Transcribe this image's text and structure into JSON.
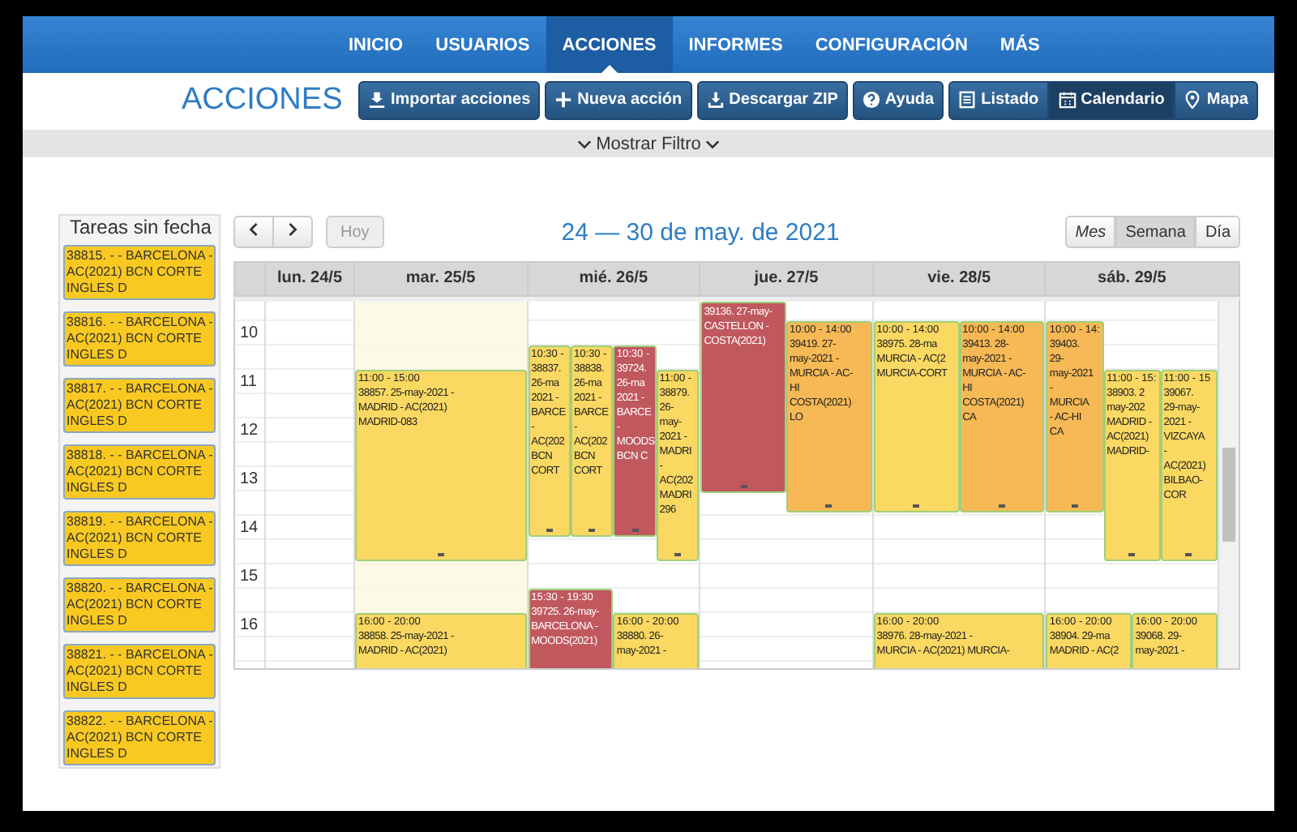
{
  "nav": [
    {
      "label": "INICIO",
      "selected": false
    },
    {
      "label": "USUARIOS",
      "selected": false
    },
    {
      "label": "ACCIONES",
      "selected": true
    },
    {
      "label": "INFORMES",
      "selected": false
    },
    {
      "label": "CONFIGURACIÓN",
      "selected": false
    },
    {
      "label": "MÁS",
      "selected": false
    }
  ],
  "page_title": "ACCIONES",
  "actions": [
    "Importar acciones",
    "Nueva acción",
    "Descargar ZIP",
    "Ayuda"
  ],
  "views": [
    {
      "label": "Listado",
      "selected": false
    },
    {
      "label": "Calendario",
      "selected": true
    },
    {
      "label": "Mapa",
      "selected": false
    }
  ],
  "filter_toggle": "Mostrar Filtro",
  "sidebar": {
    "title": "Tareas sin fecha",
    "tasks": [
      "38815. - - BARCELONA - AC(2021) BCN CORTE INGLES D",
      "38816. - - BARCELONA - AC(2021) BCN CORTE INGLES D",
      "38817. - - BARCELONA - AC(2021) BCN CORTE INGLES D",
      "38818. - - BARCELONA - AC(2021) BCN CORTE INGLES D",
      "38819. - - BARCELONA - AC(2021) BCN CORTE INGLES D",
      "38820. - - BARCELONA - AC(2021) BCN CORTE INGLES D",
      "38821. - - BARCELONA - AC(2021) BCN CORTE INGLES D",
      "38822. - - BARCELONA - AC(2021) BCN CORTE INGLES D"
    ]
  },
  "calendar": {
    "today_button": {
      "label": "Hoy",
      "disabled": true
    },
    "range_title": "24 — 30 de may. de 2021",
    "modes": [
      {
        "label": "Mes",
        "selected": false
      },
      {
        "label": "Semana",
        "selected": true
      },
      {
        "label": "Día",
        "selected": false
      }
    ],
    "hours": [
      "10",
      "11",
      "12",
      "13",
      "14",
      "15",
      "16"
    ],
    "days": [
      {
        "label": "lun. 24/5",
        "today": false
      },
      {
        "label": "mar. 25/5",
        "today": true,
        "events": [
          {
            "time": "11:00 - 15:00",
            "text": "38857. 25-may-2021 -\nMADRID - AC(2021)\nMADRID-083",
            "color": "#fad862"
          },
          {
            "time": "16:00 - 20:00",
            "text": "38858. 25-may-2021 -\nMADRID - AC(2021)",
            "color": "#fad862"
          }
        ]
      },
      {
        "label": "mié. 26/5",
        "today": false,
        "events": [
          {
            "time": "10:30 -",
            "text": "38837.\n26-ma\n2021 -\nBARCE\n-\nAC(202\nBCN\nCORT",
            "color": "#fad862"
          },
          {
            "time": "10:30 -",
            "text": "38838.\n26-ma\n2021 -\nBARCE\n-\nAC(202\nBCN\nCORT",
            "color": "#fad862"
          },
          {
            "time": "10:30 -",
            "text": "39724.\n26-ma\n2021 -\nBARCE\n-\nMOODS\nBCN C",
            "color": "#c0585e"
          },
          {
            "time": "11:00 -",
            "text": "38879.\n26-\nmay-\n2021 -\nMADRI\n-\nAC(202\nMADRI\n296",
            "color": "#fad862"
          },
          {
            "time": "15:30 - 19:30",
            "text": "39725. 26-may-\nBARCELONA -\nMOODS(2021)",
            "color": "#c0585e"
          },
          {
            "time": "16:00 - 20:00",
            "text": "38880. 26-\nmay-2021 -",
            "color": "#fad862"
          }
        ]
      },
      {
        "label": "jue. 27/5",
        "today": false,
        "events": [
          {
            "text": "39136. 27-may-\nCASTELLON -\nCOSTA(2021)",
            "color": "#c0585e"
          },
          {
            "time": "10:00 - 14:00",
            "text": "39419. 27-\nmay-2021 -\nMURCIA - AC-\nHI\nCOSTA(2021)\nLO",
            "color": "#f7b955"
          }
        ]
      },
      {
        "label": "vie. 28/5",
        "today": false,
        "events": [
          {
            "time": "10:00 - 14:00",
            "text": "38975. 28-ma\nMURCIA - AC(2\nMURCIA-CORT",
            "color": "#fad862"
          },
          {
            "time": "10:00 - 14:00",
            "text": "39413. 28-\nmay-2021 -\nMURCIA - AC-\nHI\nCOSTA(2021)\nCA",
            "color": "#f7b955"
          },
          {
            "time": "16:00 - 20:00",
            "text": "38976. 28-may-2021 -\nMURCIA - AC(2021) MURCIA-",
            "color": "#fad862"
          }
        ]
      },
      {
        "label": "sáb. 29/5",
        "today": false,
        "events": [
          {
            "time": "10:00 - 14:",
            "text": "39403.\n29-\nmay-2021\n-\nMURCIA\n- AC-HI\nCA",
            "color": "#f7b955"
          },
          {
            "time": "11:00 - 15:",
            "text": "38903. 2\nmay-202\nMADRID -\nAC(2021)\nMADRID-",
            "color": "#fad862"
          },
          {
            "time": "11:00 - 15",
            "text": "39067.\n29-may-\n2021 -\nVIZCAYA\n-\nAC(2021)\nBILBAO-\nCOR",
            "color": "#fad862"
          },
          {
            "time": "16:00 - 20:00",
            "text": "38904. 29-ma\nMADRID - AC(2",
            "color": "#fad862"
          },
          {
            "time": "16:00 - 20:00",
            "text": "39068. 29-\nmay-2021 -",
            "color": "#fad862"
          }
        ]
      }
    ]
  }
}
